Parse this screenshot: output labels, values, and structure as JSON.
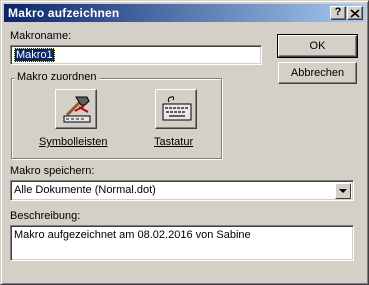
{
  "window": {
    "title": "Makro aufzeichnen",
    "help_btn": "?",
    "close_btn": "X"
  },
  "form": {
    "name_label": "Makroname:",
    "name_value": "Makro1",
    "assign_label": "Makro zuordnen",
    "toolbar_btn_label": "Symbolleisten",
    "keyboard_btn_label": "Tastatur",
    "store_label": "Makro speichern:",
    "store_value": "Alle Dokumente (Normal.dot)",
    "desc_label": "Beschreibung:",
    "desc_value": "Makro aufgezeichnet am 08.02.2016 von Sabine"
  },
  "buttons": {
    "ok": "OK",
    "cancel": "Abbrechen"
  },
  "icons": {
    "toolbar": "hammer-icon",
    "keyboard": "keyboard-icon",
    "dropdown": "chevron-down-icon"
  },
  "colors": {
    "titlebar_start": "#0a246a",
    "titlebar_end": "#a6caf0",
    "dialog_bg": "#d4d0c8",
    "selection": "#0a246a"
  }
}
